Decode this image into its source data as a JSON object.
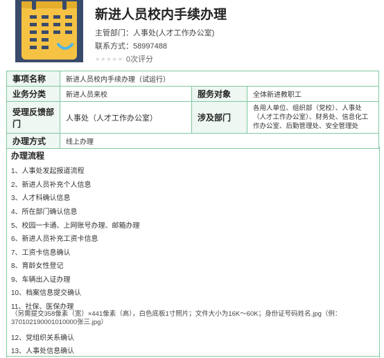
{
  "header": {
    "title": "新进人员校内手续办理",
    "department": "主管部门：人事处(人才工作办公室)",
    "contact": "联系方式：58997488",
    "rating": "0次评分",
    "stars": "★★★★★"
  },
  "colors": {
    "icon_bg": "#3a4a6b",
    "icon_accent": "#f6c244",
    "border": "#7ec8a0"
  },
  "table": {
    "item_name_label": "事项名称",
    "item_name": "新进人员校内手续办理（试运行）",
    "category_label": "业务分类",
    "category": "新进人员来校",
    "target_label": "服务对象",
    "target": "全体新进教职工",
    "feedback_label": "受理反馈部门",
    "feedback": "人事处（人才工作办公室）",
    "involved_label": "涉及部门",
    "involved": "各用人单位、组织部（党校）、人事处（人才工作办公室）、财务处、信息化工作办公室、后勤管理处、安全管理处",
    "method_label": "办理方式",
    "method": "线上办理"
  },
  "procedure": {
    "title": "办理流程",
    "steps": [
      "1、人事处发起报道流程",
      "2、新进人员补充个人信息",
      "3、人才科确认信息",
      "4、所在部门确认信息",
      "5、校园一卡通、上网账号办理、邮箱办理",
      "6、新进人员补充工资卡信息",
      "7、工资卡信息确认",
      "8、育龄女性登记",
      "9、车辆出入证办理",
      "10、档案信息提交确认",
      "11、社保、医保办理",
      "12、党组织关系确认",
      "13、人事处信息确认"
    ],
    "note": "（另需提交358像素（宽）×441像素（高），白色底板1寸照片；文件大小为16K～60K；身份证号码姓名.jpg（例：370102190001010000张三.jpg）"
  }
}
